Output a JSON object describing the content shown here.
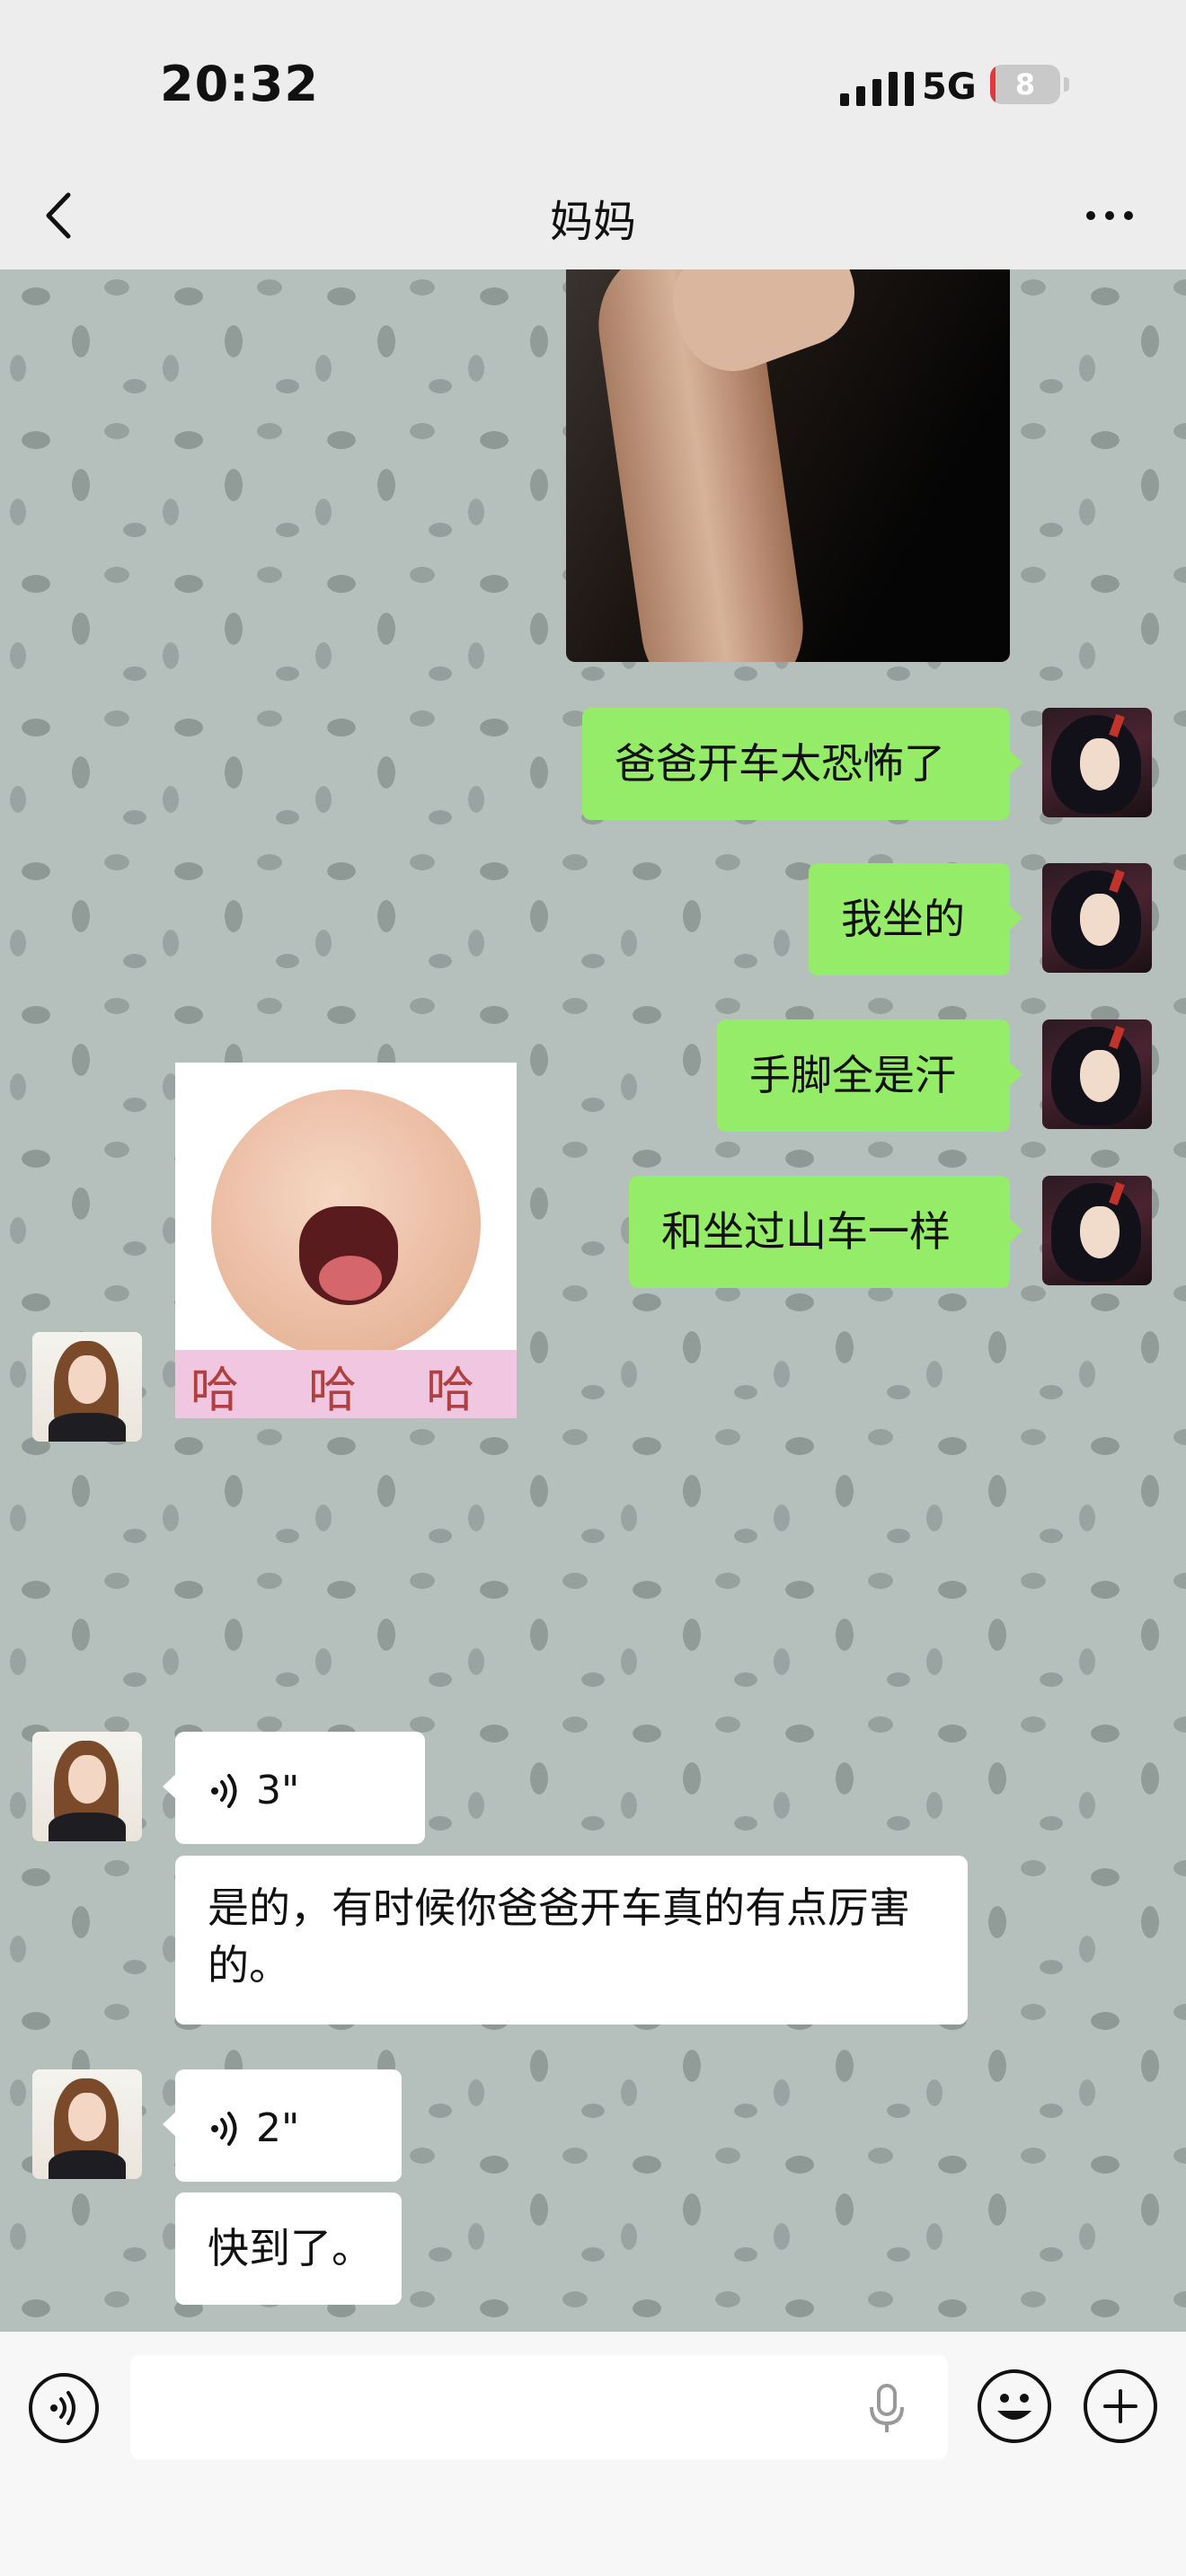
{
  "status_bar": {
    "time": "20:32",
    "network": "5G",
    "battery_level": "8",
    "battery_fraction": 0.08
  },
  "header": {
    "title": "妈妈",
    "back_icon": "chevron-left-icon",
    "more_icon": "more-dots-icon"
  },
  "messages": {
    "me_1": "爸爸开车太恐怖了",
    "me_2": "我坐的",
    "me_3": "手脚全是汗",
    "me_4": "和坐过山车一样",
    "sticker_caption": "哈 哈 哈",
    "voice_1_duration": "3\"",
    "text_1": "是的，有时候你爸爸开车真的有点厉害的。",
    "voice_2_duration": "2\"",
    "text_2": "快到了。"
  },
  "input_bar": {
    "voice_icon": "voice-mode-icon",
    "mic_icon": "microphone-icon",
    "emoji_icon": "emoji-icon",
    "plus_icon": "plus-icon"
  },
  "colors": {
    "my_bubble": "#95ec69",
    "their_bubble": "#ffffff",
    "bar_bg": "#ededed",
    "battery_low": "#e0383c"
  }
}
